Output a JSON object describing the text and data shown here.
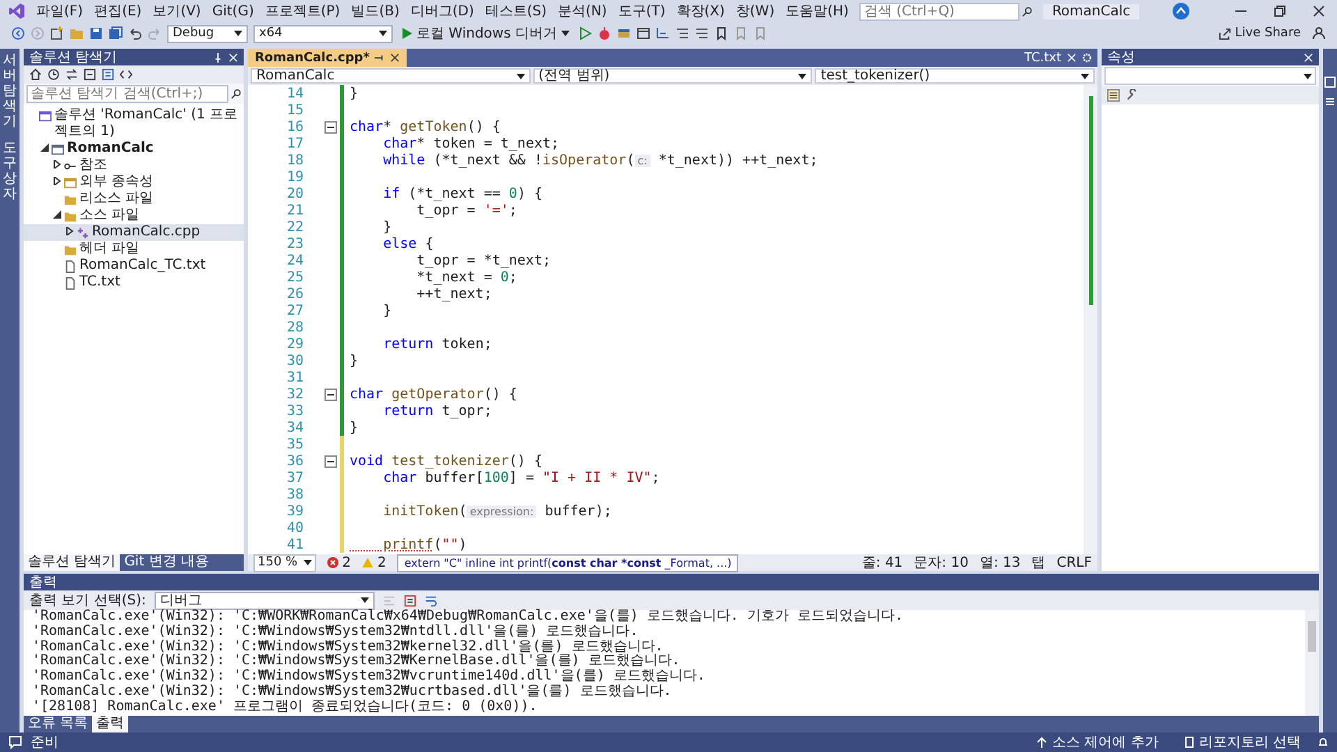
{
  "menu_bar": {
    "items": [
      "파일(F)",
      "편집(E)",
      "보기(V)",
      "Git(G)",
      "프로젝트(P)",
      "빌드(B)",
      "디버그(D)",
      "테스트(S)",
      "분석(N)",
      "도구(T)",
      "확장(X)",
      "창(W)",
      "도움말(H)"
    ],
    "search": {
      "placeholder": "검색 (Ctrl+Q)"
    },
    "title": "RomanCalc"
  },
  "toolbar": {
    "configuration": "Debug",
    "platform": "x64",
    "run_button": "로컬 Windows 디버거",
    "live_share": "Live Share"
  },
  "left_strip": {
    "tabs": [
      "서버 탐색기",
      "도구 상자"
    ]
  },
  "solution_explorer": {
    "title": "솔루션 탐색기",
    "search": {
      "placeholder": "솔루션 탐색기 검색(Ctrl+;)"
    },
    "tree": [
      {
        "label": "솔루션 'RomanCalc' (1 프로젝트의 1)",
        "kind": "solution",
        "selected": false,
        "children": [
          {
            "label": "RomanCalc",
            "kind": "project",
            "selected": false,
            "expanded": true,
            "children": [
              {
                "label": "참조",
                "kind": "references",
                "selected": false,
                "expanded": false
              },
              {
                "label": "외부 종속성",
                "kind": "dependencies",
                "selected": false,
                "expanded": false
              },
              {
                "label": "리소스 파일",
                "kind": "folder",
                "selected": false
              },
              {
                "label": "소스 파일",
                "kind": "folder",
                "selected": false,
                "expanded": true,
                "children": [
                  {
                    "label": "RomanCalc.cpp",
                    "kind": "cpp",
                    "selected": true,
                    "expanded": false
                  }
                ]
              },
              {
                "label": "헤더 파일",
                "kind": "folder",
                "selected": false
              },
              {
                "label": "RomanCalc_TC.txt",
                "kind": "text",
                "selected": false
              },
              {
                "label": "TC.txt",
                "kind": "text",
                "selected": false
              }
            ]
          }
        ]
      }
    ],
    "tabs": [
      {
        "label": "솔루션 탐색기",
        "selected": true
      },
      {
        "label": "Git 변경 내용",
        "selected": false
      }
    ]
  },
  "editor": {
    "tabs": [
      {
        "label": "RomanCalc.cpp*",
        "selected": true
      }
    ],
    "preview_tab": "TC.txt",
    "nav": [
      "RomanCalc",
      "(전역 범위)",
      "test_tokenizer()"
    ],
    "lines": [
      {
        "number": "14",
        "tokens": [
          {
            "text": "}",
            "kind": "plain"
          }
        ],
        "fold": false,
        "unsaved": false
      },
      {
        "number": "15",
        "fold": false,
        "unsaved": false
      },
      {
        "number": "16",
        "tokens": [
          {
            "text": "char",
            "kind": "keyword"
          },
          {
            "text": "* ",
            "kind": "plain"
          },
          {
            "text": "getToken",
            "kind": "function"
          },
          {
            "text": "() {",
            "kind": "plain"
          }
        ],
        "fold": true,
        "unsaved": false
      },
      {
        "number": "17",
        "tokens": [
          {
            "text": "    char",
            "kind": "keyword"
          },
          {
            "text": "* token = t_next;",
            "kind": "plain"
          }
        ],
        "fold": false,
        "unsaved": false
      },
      {
        "number": "18",
        "tokens": [
          {
            "text": "    while",
            "kind": "keyword"
          },
          {
            "text": " (*t_next && !",
            "kind": "plain"
          },
          {
            "text": "isOperator",
            "kind": "function"
          },
          {
            "text": "(",
            "kind": "plain"
          },
          {
            "text": "c:",
            "kind": "hint"
          },
          {
            "text": " *t_next)) ++t_next;",
            "kind": "plain"
          }
        ],
        "fold": false,
        "unsaved": false
      },
      {
        "number": "19",
        "fold": false,
        "unsaved": false
      },
      {
        "number": "20",
        "tokens": [
          {
            "text": "    if",
            "kind": "keyword"
          },
          {
            "text": " (*t_next == ",
            "kind": "plain"
          },
          {
            "text": "0",
            "kind": "number"
          },
          {
            "text": ") {",
            "kind": "plain"
          }
        ],
        "fold": false,
        "unsaved": false
      },
      {
        "number": "21",
        "tokens": [
          {
            "text": "        t_opr = ",
            "kind": "plain"
          },
          {
            "text": "'='",
            "kind": "string"
          },
          {
            "text": ";",
            "kind": "plain"
          }
        ],
        "fold": false,
        "unsaved": false
      },
      {
        "number": "22",
        "tokens": [
          {
            "text": "    }",
            "kind": "plain"
          }
        ],
        "fold": false,
        "unsaved": false
      },
      {
        "number": "23",
        "tokens": [
          {
            "text": "    else",
            "kind": "keyword"
          },
          {
            "text": " {",
            "kind": "plain"
          }
        ],
        "fold": false,
        "unsaved": false
      },
      {
        "number": "24",
        "tokens": [
          {
            "text": "        t_opr = *t_next;",
            "kind": "plain"
          }
        ],
        "fold": false,
        "unsaved": false
      },
      {
        "number": "25",
        "tokens": [
          {
            "text": "        *t_next = ",
            "kind": "plain"
          },
          {
            "text": "0",
            "kind": "number"
          },
          {
            "text": ";",
            "kind": "plain"
          }
        ],
        "fold": false,
        "unsaved": false
      },
      {
        "number": "26",
        "tokens": [
          {
            "text": "        ++t_next;",
            "kind": "plain"
          }
        ],
        "fold": false,
        "unsaved": false
      },
      {
        "number": "27",
        "tokens": [
          {
            "text": "    }",
            "kind": "plain"
          }
        ],
        "fold": false,
        "unsaved": false
      },
      {
        "number": "28",
        "fold": false,
        "unsaved": false
      },
      {
        "number": "29",
        "tokens": [
          {
            "text": "    return",
            "kind": "keyword"
          },
          {
            "text": " token;",
            "kind": "plain"
          }
        ],
        "fold": false,
        "unsaved": false
      },
      {
        "number": "30",
        "tokens": [
          {
            "text": "}",
            "kind": "plain"
          }
        ],
        "fold": false,
        "unsaved": false
      },
      {
        "number": "31",
        "fold": false,
        "unsaved": false
      },
      {
        "number": "32",
        "tokens": [
          {
            "text": "char",
            "kind": "keyword"
          },
          {
            "text": " getOperator",
            "kind": "function"
          },
          {
            "text": "() {",
            "kind": "plain"
          }
        ],
        "fold": true,
        "unsaved": false
      },
      {
        "number": "33",
        "tokens": [
          {
            "text": "    return",
            "kind": "keyword"
          },
          {
            "text": " t_opr;",
            "kind": "plain"
          }
        ],
        "fold": false,
        "unsaved": false
      },
      {
        "number": "34",
        "tokens": [
          {
            "text": "}",
            "kind": "plain"
          }
        ],
        "fold": false,
        "unsaved": false
      },
      {
        "number": "35",
        "fold": false,
        "unsaved": true
      },
      {
        "number": "36",
        "tokens": [
          {
            "text": "void",
            "kind": "keyword"
          },
          {
            "text": " test_tokenizer",
            "kind": "function"
          },
          {
            "text": "() {",
            "kind": "plain"
          }
        ],
        "fold": true,
        "unsaved": true
      },
      {
        "number": "37",
        "tokens": [
          {
            "text": "    char",
            "kind": "keyword"
          },
          {
            "text": " buffer[",
            "kind": "plain"
          },
          {
            "text": "100",
            "kind": "number"
          },
          {
            "text": "] = ",
            "kind": "plain"
          },
          {
            "text": "\"I + II * IV\"",
            "kind": "string"
          },
          {
            "text": ";",
            "kind": "plain"
          }
        ],
        "fold": false,
        "unsaved": true
      },
      {
        "number": "38",
        "fold": false,
        "unsaved": true
      },
      {
        "number": "39",
        "tokens": [
          {
            "text": "    initToken",
            "kind": "function"
          },
          {
            "text": "(",
            "kind": "plain"
          },
          {
            "text": "expression:",
            "kind": "hint"
          },
          {
            "text": " buffer);",
            "kind": "plain"
          }
        ],
        "fold": false,
        "unsaved": true
      },
      {
        "number": "40",
        "fold": false,
        "unsaved": true
      },
      {
        "number": "41",
        "tokens": [
          {
            "text": "    printf",
            "kind": "error"
          },
          {
            "text": "(",
            "kind": "plain"
          },
          {
            "text": "\"\"",
            "kind": "string"
          },
          {
            "text": ")",
            "kind": "plain"
          }
        ],
        "fold": false,
        "unsaved": true
      }
    ],
    "status": {
      "zoom": "150 %",
      "errors": "2",
      "warnings": "2",
      "tooltip": "extern \"C\" inline int printf(**const char *const** _Format, ...)",
      "line": "줄: 41",
      "char": "문자: 10",
      "col": "열: 13",
      "indent": "탭",
      "eol": "CRLF"
    }
  },
  "properties": {
    "title": "속성"
  },
  "output": {
    "title": "출력",
    "source_label": "출력 보기 선택(S):",
    "source": "디버그",
    "lines": [
      "'RomanCalc.exe'(Win32): 'C:₩WORK₩RomanCalc₩x64₩Debug₩RomanCalc.exe'을(를) 로드했습니다. 기호가 로드되었습니다.",
      "'RomanCalc.exe'(Win32): 'C:₩Windows₩System32₩ntdll.dll'을(를) 로드했습니다.",
      "'RomanCalc.exe'(Win32): 'C:₩Windows₩System32₩kernel32.dll'을(를) 로드했습니다.",
      "'RomanCalc.exe'(Win32): 'C:₩Windows₩System32₩KernelBase.dll'을(를) 로드했습니다.",
      "'RomanCalc.exe'(Win32): 'C:₩Windows₩System32₩vcruntime140d.dll'을(를) 로드했습니다.",
      "'RomanCalc.exe'(Win32): 'C:₩Windows₩System32₩ucrtbased.dll'을(를) 로드했습니다.",
      "'[28108] RomanCalc.exe' 프로그램이 종료되었습니다(코드: 0 (0x0))."
    ],
    "tabs": [
      {
        "label": "오류 목록",
        "selected": false
      },
      {
        "label": "출력",
        "selected": true
      }
    ]
  },
  "status_bar": {
    "text": "준비",
    "source_control": "소스 제어에 추가",
    "repository": "리포지토리 선택"
  }
}
